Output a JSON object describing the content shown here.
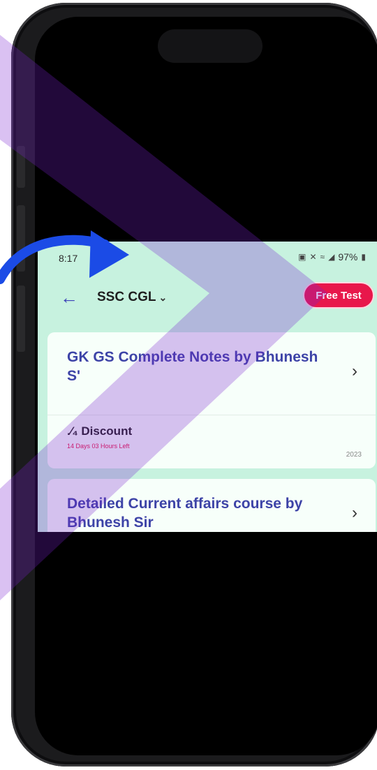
{
  "status_bar": {
    "time": "8:17",
    "battery": "97%"
  },
  "header": {
    "exam_name": "SSC CGL",
    "free_test_label": "Free Test"
  },
  "courses": [
    {
      "title": "GK GS Complete Notes by Bhunesh S'",
      "discount_label": ".⁄₄ Discount",
      "time_left": "14 Days 03 Hours Left",
      "year": "2023"
    },
    {
      "title": "Detailed Current affairs course by Bhunesh Sir"
    }
  ],
  "colors": {
    "app_background": "#c7f2df",
    "accent_red": "#e8174b",
    "title_blue": "#3d43a7",
    "overlay_purple": "#7a1fd1",
    "arrow_blue": "#1b4be6"
  },
  "icons": {
    "back": "back-arrow-icon",
    "dropdown": "chevron-down-icon",
    "course_open": "chevron-right-icon",
    "overlay_arrow": "curved-arrow-icon"
  }
}
